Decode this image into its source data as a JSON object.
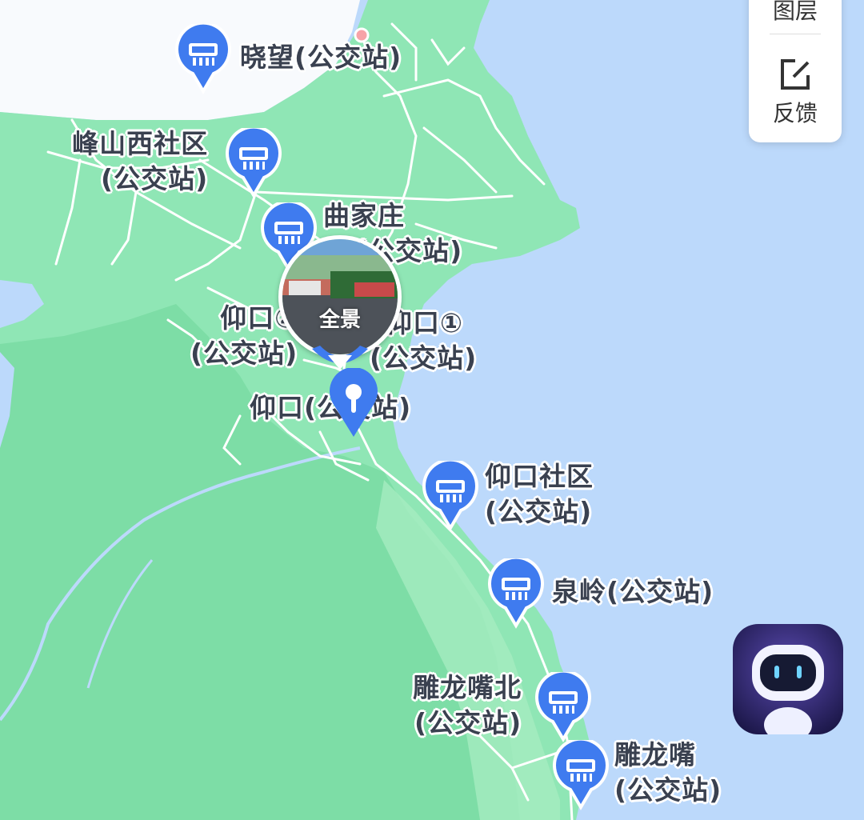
{
  "panel": {
    "layers_label": "图层",
    "feedback_label": "反馈"
  },
  "panorama": {
    "label": "全景"
  },
  "bus_stops": [
    {
      "name": "晓望(公交站)",
      "lines": [
        "晓望(公交站)"
      ]
    },
    {
      "name": "峰山西社区(公交站)",
      "lines": [
        "峰山西社区",
        "(公交站)"
      ]
    },
    {
      "name": "曲家庄(公交站)",
      "lines": [
        "曲家庄",
        "(公交站)"
      ]
    },
    {
      "name": "仰口②(公交站)",
      "lines": [
        "仰口②",
        "(公交站)"
      ]
    },
    {
      "name": "仰口①(公交站)",
      "lines": [
        "仰口①",
        "(公交站)"
      ]
    },
    {
      "name": "仰口(公交站)",
      "lines": [
        "仰口(公交站)"
      ]
    },
    {
      "name": "仰口社区(公交站)",
      "lines": [
        "仰口社区",
        "(公交站)"
      ]
    },
    {
      "name": "泉岭(公交站)",
      "lines": [
        "泉岭(公交站)"
      ]
    },
    {
      "name": "雕龙嘴北(公交站)",
      "lines": [
        "雕龙嘴北",
        "(公交站)"
      ]
    },
    {
      "name": "雕龙嘴(公交站)",
      "lines": [
        "雕龙嘴",
        "(公交站)"
      ]
    }
  ],
  "colors": {
    "sea": "#bcd9fb",
    "land": "#8fe6b5",
    "land_dark": "#7ddda6",
    "pin": "#3f7bef",
    "road": "#ffffff"
  },
  "icons": {
    "bus_stop": "bus-icon",
    "location_pin": "location-pin-icon",
    "feedback": "edit-square-icon",
    "assistant": "robot-icon"
  }
}
